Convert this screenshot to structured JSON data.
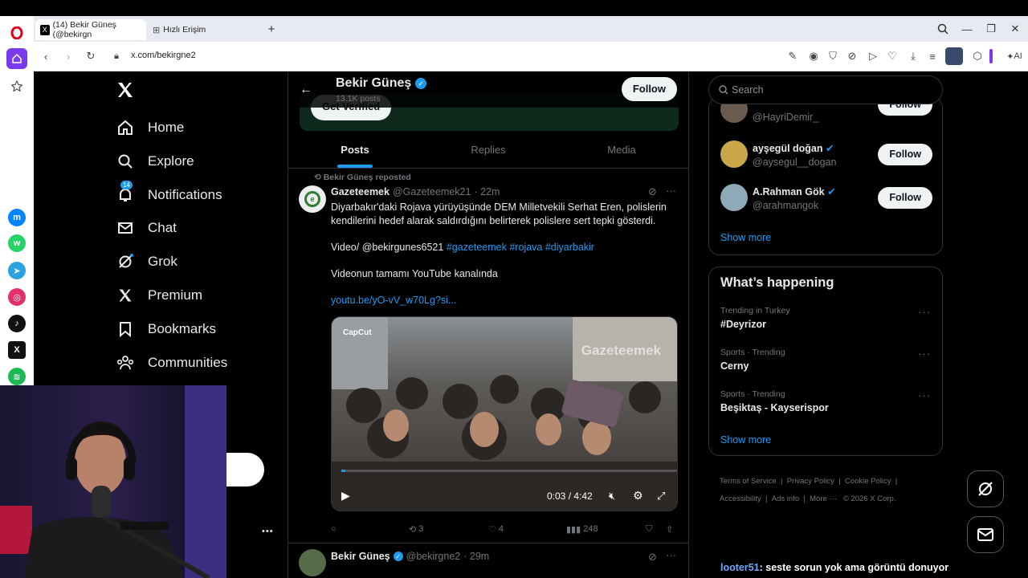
{
  "browser": {
    "tabs": [
      {
        "label": "(14) Bekir Güneş (@bekirgn"
      },
      {
        "label": "Hızlı Erişim"
      }
    ],
    "url": "x.com/bekirgne2",
    "ai_label": "AI"
  },
  "profile": {
    "name": "Bekir Güneş",
    "posts_count": "13.1K posts",
    "follow_label": "Follow",
    "get_verified_label": "Get Verified",
    "tabs": [
      "Posts",
      "Replies",
      "Media"
    ]
  },
  "nav": {
    "items": [
      {
        "label": "Home",
        "icon": "home-icon"
      },
      {
        "label": "Explore",
        "icon": "search-icon"
      },
      {
        "label": "Notifications",
        "icon": "bell-icon",
        "badge": "14"
      },
      {
        "label": "Chat",
        "icon": "mail-icon"
      },
      {
        "label": "Grok",
        "icon": "grok-icon"
      },
      {
        "label": "Premium",
        "icon": "x-icon"
      },
      {
        "label": "Bookmarks",
        "icon": "bookmark-icon"
      },
      {
        "label": "Communities",
        "icon": "people-icon"
      }
    ],
    "more_dots": "•••"
  },
  "tweet": {
    "repost_label": "Bekir Güneş reposted",
    "author": "Gazeteemek",
    "handle": "@Gazeteemek21",
    "time": "· 22m",
    "text_line1": "Diyarbakır'daki Rojava yürüyüşünde DEM Milletvekili Serhat Eren, polislerin",
    "text_line2": "kendilerini hedef alarak saldırdığını belirterek polislere sert tepki gösterdi.",
    "video_credit": "Video/ @bekirgunes6521",
    "hashtags": "#gazeteemek #rojava #diyarbakir",
    "youtube_line": "Videonun tamamı YouTube kanalında",
    "link": "youtu.be/yO-vV_w70Lg?si...",
    "video_watermark_left": "CapCut",
    "video_watermark_right": "Gazeteemek",
    "video_time": "0:03 / 4:42",
    "retweets": "3",
    "likes": "4",
    "views": "248"
  },
  "next_tweet": {
    "author": "Bekir Güneş",
    "handle": "@bekirgne2",
    "time": "· 29m"
  },
  "right": {
    "search_placeholder": "Search",
    "who_to_follow": [
      {
        "name": "",
        "handle": "@HayriDemir_",
        "follow": "Follow"
      },
      {
        "name": "ayşegül doğan",
        "handle": "@aysegul__dogan",
        "follow": "Follow"
      },
      {
        "name": "A.Rahman Gök",
        "handle": "@arahmangok",
        "follow": "Follow"
      }
    ],
    "show_more_1": "Show more",
    "happening_title": "What’s happening",
    "trends": [
      {
        "meta": "Trending in Turkey",
        "name": "#Deyrizor"
      },
      {
        "meta": "Sports · Trending",
        "name": "Cerny"
      },
      {
        "meta": "Sports · Trending",
        "name": "Beşiktaş - Kayserispor"
      }
    ],
    "show_more_2": "Show more",
    "footer": {
      "terms": "Terms of Service",
      "privacy": "Privacy Policy",
      "cookie": "Cookie Policy",
      "accessibility": "Accessibility",
      "ads": "Ads info",
      "more": "More ···",
      "copyright": "© 2026 X Corp."
    }
  },
  "chat_overlay": {
    "user": "looter51",
    "message": ": seste sorun yok ama görüntü donuyor"
  },
  "colors": {
    "accent": "#1d9bf0",
    "opera_red": "#e0001b",
    "opera_purple": "#7c3aed"
  }
}
